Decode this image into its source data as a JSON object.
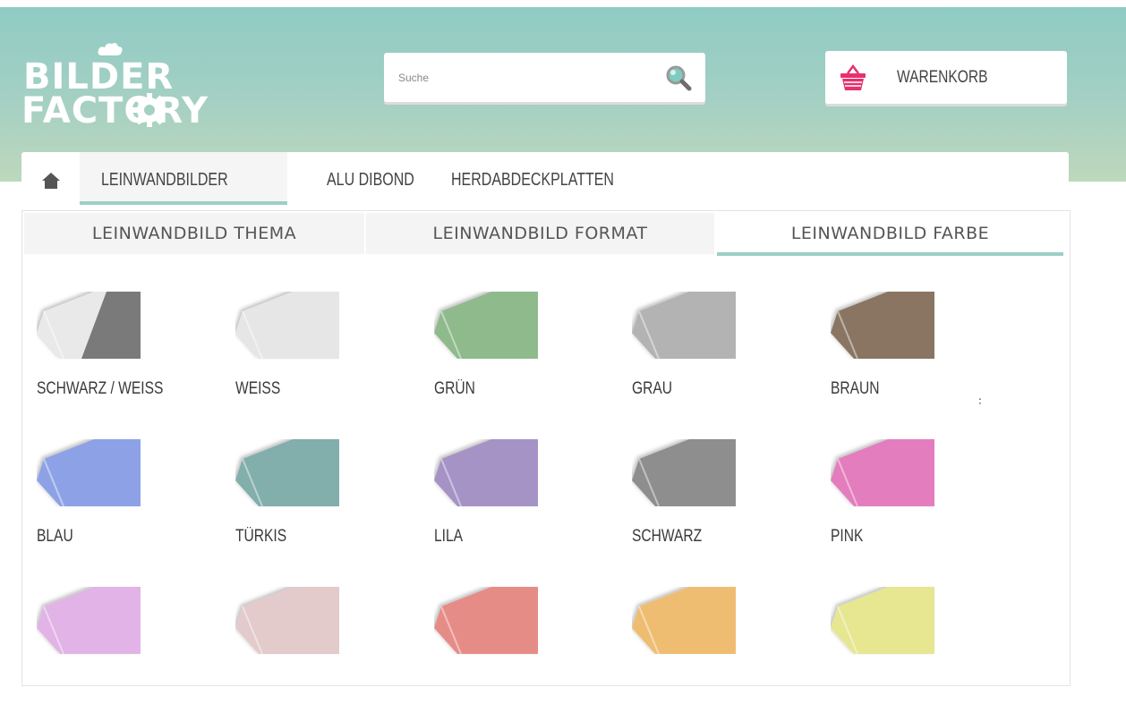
{
  "header": {
    "logo_line1": "BILDER",
    "logo_line2": "FACTORY",
    "search": {
      "placeholder": "Suche",
      "value": ""
    },
    "cart_label": "WARENKORB"
  },
  "nav": {
    "items": [
      {
        "label": "LEINWANDBILDER",
        "active": true
      },
      {
        "label": "ALU DIBOND",
        "active": false
      },
      {
        "label": "HERDABDECKPLATTEN",
        "active": false
      }
    ]
  },
  "subtabs": [
    {
      "label": "LEINWANDBILD THEMA",
      "active": false
    },
    {
      "label": "LEINWANDBILD FORMAT",
      "active": false
    },
    {
      "label": "LEINWANDBILD FARBE",
      "active": true
    }
  ],
  "colors": [
    {
      "label": "SCHWARZ / WEISS",
      "color": "#e9e9e9",
      "color2": "#7a7a7a"
    },
    {
      "label": "WEISS",
      "color": "#e6e6e6"
    },
    {
      "label": "GRÜN",
      "color": "#8fba8c"
    },
    {
      "label": "GRAU",
      "color": "#b3b3b3"
    },
    {
      "label": "BRAUN",
      "color": "#8a7462"
    },
    {
      "label": "BLAU",
      "color": "#8da2e6"
    },
    {
      "label": "TÜRKIS",
      "color": "#82aeab"
    },
    {
      "label": "LILA",
      "color": "#a593c6"
    },
    {
      "label": "SCHWARZ",
      "color": "#8e8e8e"
    },
    {
      "label": "PINK",
      "color": "#e37dbd"
    },
    {
      "label": "",
      "color": "#e2b3e6"
    },
    {
      "label": "",
      "color": "#e3cacb"
    },
    {
      "label": "",
      "color": "#e68c87"
    },
    {
      "label": "",
      "color": "#efbd72"
    },
    {
      "label": "",
      "color": "#e7e691"
    }
  ],
  "stray_glyph": "꞉",
  "accent_color": "#9ccfc7",
  "cart_icon_color": "#e8306e"
}
